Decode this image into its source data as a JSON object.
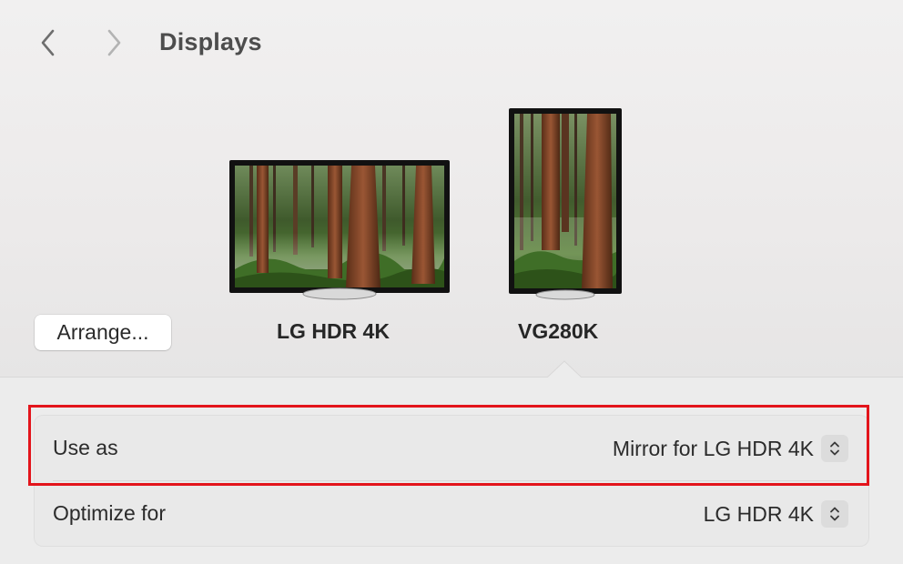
{
  "header": {
    "title": "Displays",
    "back_icon": "chevron-left-icon",
    "forward_icon": "chevron-right-icon"
  },
  "arrangement": {
    "arrange_label": "Arrange...",
    "displays": [
      {
        "name": "LG HDR 4K",
        "orientation": "landscape",
        "selected": false
      },
      {
        "name": "VG280K",
        "orientation": "portrait",
        "selected": true
      }
    ]
  },
  "settings": {
    "rows": [
      {
        "label": "Use as",
        "value": "Mirror for LG HDR 4K"
      },
      {
        "label": "Optimize for",
        "value": "LG HDR 4K"
      }
    ]
  },
  "colors": {
    "highlight": "#e3141b",
    "background": "#ececec"
  }
}
